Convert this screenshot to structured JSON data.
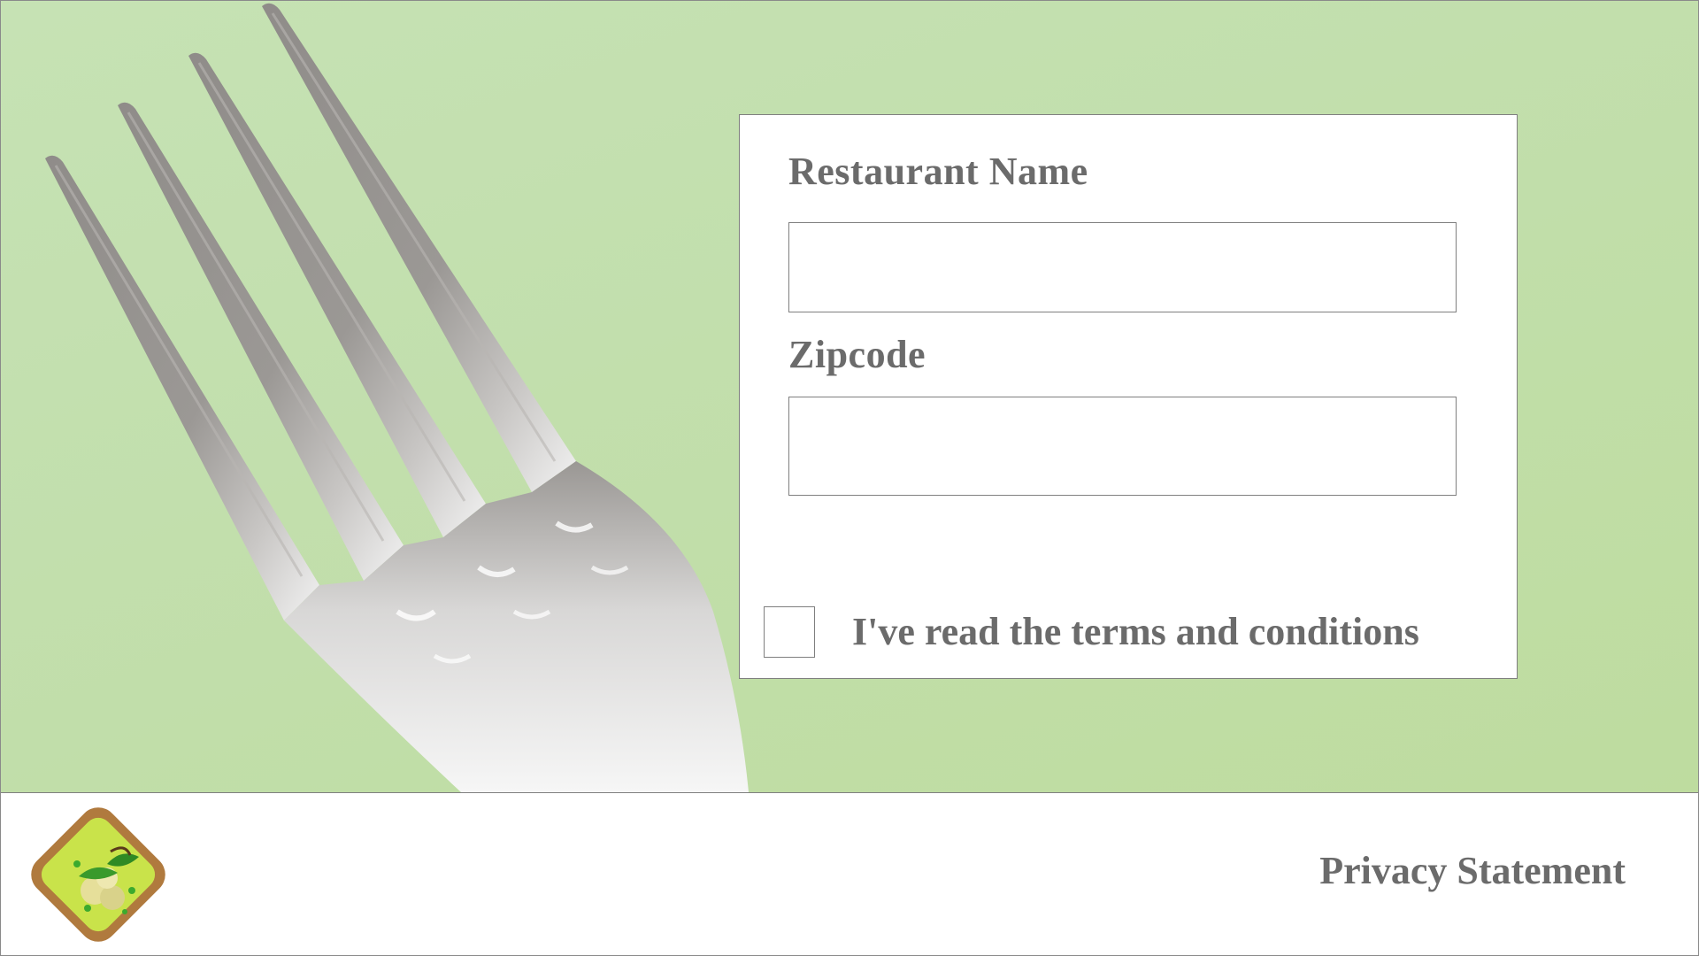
{
  "form": {
    "restaurant_name_label": "Restaurant Name",
    "restaurant_name_value": "",
    "zipcode_label": "Zipcode",
    "zipcode_value": "",
    "terms_label": "I've read the terms and conditions",
    "terms_checked": false
  },
  "footer": {
    "logo_icon": "food-bowl-logo-icon",
    "privacy_label": "Privacy Statement"
  },
  "hero": {
    "image": "fork-on-green-background"
  },
  "colors": {
    "background_green": "#c2dfad",
    "text_gray": "#6b6b6b",
    "border_gray": "#7f7f7f"
  }
}
